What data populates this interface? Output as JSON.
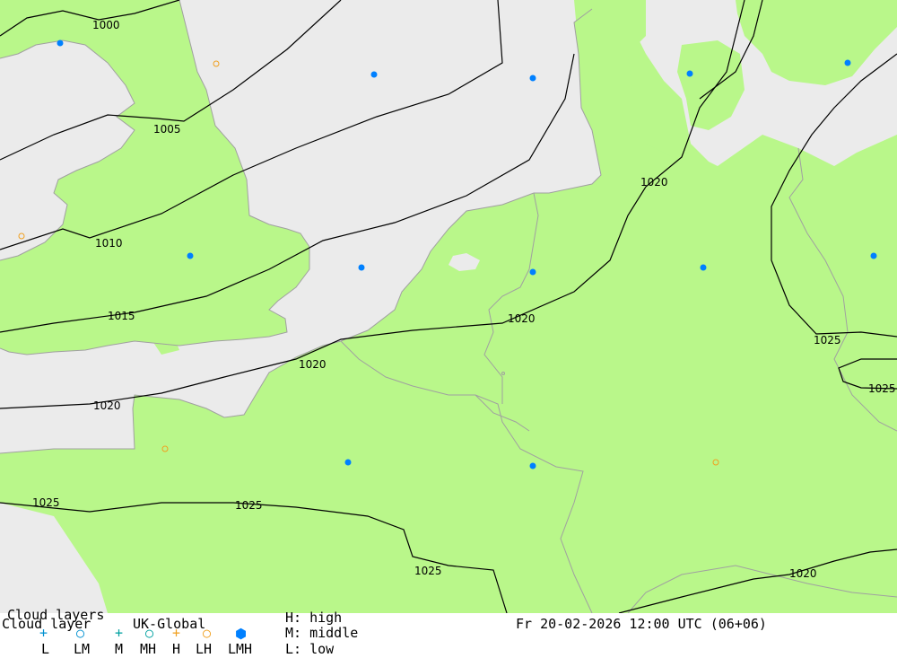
{
  "colors": {
    "sea": "#ebebeb",
    "land": "#b9f78a",
    "coast": "#a0a0a0",
    "isobar": "#000000",
    "lmh_marker": "#0080ff",
    "lh_marker": "#f0a020",
    "l_symbol": "#0090d0",
    "m_symbol": "#00a0a0"
  },
  "isobar_labels": [
    "1000",
    "1005",
    "1010",
    "1015",
    "1020",
    "1020",
    "1020",
    "1020",
    "1020",
    "1025",
    "1025",
    "1025",
    "1025",
    "1025",
    "1020"
  ],
  "markers": {
    "lmh_count": 12,
    "lh_count": 5
  },
  "legend": {
    "title_top": "Cloud layers",
    "title": "Cloud layer",
    "model": "UK-Global",
    "h_label": "H: high",
    "m_label": "M: middle",
    "l_label": "L: low",
    "symbols": {
      "L": "L",
      "LM": "LM",
      "M": "M",
      "MH": "MH",
      "H": "H",
      "LH": "LH",
      "LMH": "LMH"
    },
    "datetime": "Fr 20-02-2026 12:00 UTC (06+06)"
  }
}
